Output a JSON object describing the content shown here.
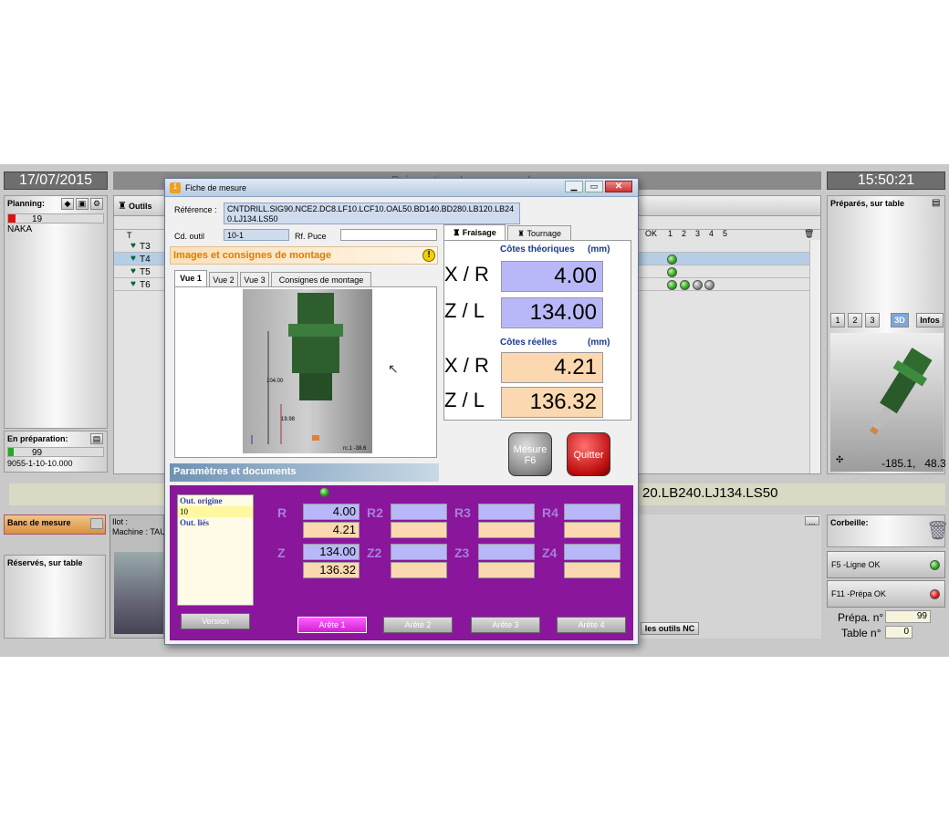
{
  "app": {
    "date": "17/07/2015",
    "time": "15:50:21",
    "window_title_partial": "Préparation des commandes",
    "ref_strip": "20.LB240.LJ134.LS50"
  },
  "left": {
    "planning_label": "Planning:",
    "planning_count": "19",
    "planning_name": "NAKA",
    "en_prep_label": "En préparation:",
    "en_prep_count": "99",
    "en_prep_id": "9055-1-10-10.000",
    "banc_label": "Banc de mesure",
    "reserves_label": "Réservés, sur table"
  },
  "center": {
    "outils_label": "Outils",
    "col_t": "T",
    "rows": [
      "T3",
      "T4",
      "T5",
      "T6"
    ],
    "col_headers": [
      "OK",
      "1",
      "2",
      "3",
      "4",
      "5"
    ],
    "ilot_label": "Ilot :",
    "machine_label": "Machine : TAU",
    "outils_nc_btn": "les outils NC",
    "more_btn": "..."
  },
  "right": {
    "prepares_label": "Préparés, sur table",
    "view_buttons": [
      "1",
      "2",
      "3",
      "3D",
      "Infos"
    ],
    "coords": "-185.1,   48.3",
    "corbeille_label": "Corbeille:",
    "f5_label": "F5 -Ligne OK",
    "f11_label": "F11 -Prépa OK",
    "prepa_label": "Prépa. n°",
    "prepa_value": "99",
    "table_label": "Table n°",
    "table_value": "0"
  },
  "dialog": {
    "title": "Fiche de mesure",
    "reference_label": "Référence :",
    "reference_value": "CNTDRILL.SIG90.NCE2.DC8.LF10.LCF10.OAL50.BD140.BD280.LB120.LB240.LJ134.LS50",
    "cd_outil_label": "Cd. outil",
    "cd_outil_value": "10-1",
    "rf_puce_label": "Rf. Puce",
    "rf_puce_value": "",
    "images_header": "Images et consignes de montage",
    "view_tabs": [
      "Vue 1",
      "Vue 2",
      "Vue 3",
      "Consignes de montage"
    ],
    "image_labels": {
      "dim1": "104.00",
      "dim2": "19.98",
      "corner": "rc.1 -38.6"
    },
    "tabs": [
      "Fraisage",
      "Tournage"
    ],
    "theo_header": "Côtes théoriques",
    "unit": "(mm)",
    "reel_header": "Côtes réelles",
    "xr_label": "X / R",
    "zl_label": "Z / L",
    "theo_xr": "4.00",
    "theo_zl": "134.00",
    "reel_xr": "4.21",
    "reel_zl": "136.32",
    "mesure_btn": "Mesure\nF6",
    "quitter_btn": "Quitter",
    "params_header": "Paramètres et documents",
    "list_items": [
      "Out. origine",
      "10",
      "Out. liés"
    ],
    "version_btn": "Version",
    "r_labels": [
      "R",
      "R2",
      "R3",
      "R4"
    ],
    "z_labels": [
      "Z",
      "Z2",
      "Z3",
      "Z4"
    ],
    "r_theo": "4.00",
    "r_reel": "4.21",
    "z_theo": "134.00",
    "z_reel": "136.32",
    "arete_tabs": [
      "Arête 1",
      "Arête 2",
      "Arête 3",
      "Arête 4"
    ]
  }
}
